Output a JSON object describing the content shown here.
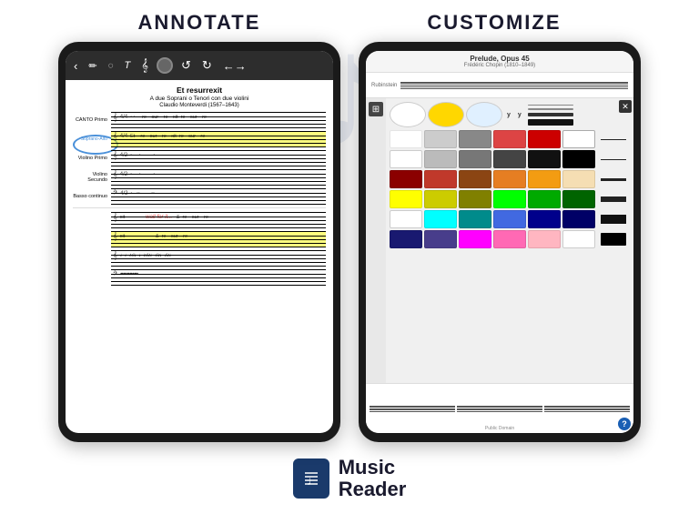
{
  "header": {
    "annotate_label": "ANNOTATE",
    "customize_label": "CUSTOMIZE"
  },
  "left_tablet": {
    "sheet": {
      "title": "Et resurrexit",
      "subtitle": "A due Soprani o Tenori con due violini",
      "composer": "Claudio Monteverdi (1567–1643)",
      "voices": [
        {
          "label": "CANTO Primo",
          "highlighted": false
        },
        {
          "label": "Soprano-Alto",
          "highlighted": true,
          "annotation": "wait for it..."
        },
        {
          "label": "Violino Primo",
          "highlighted": false
        },
        {
          "label": "Violino Secundo",
          "highlighted": false
        },
        {
          "label": "Basso continuo",
          "highlighted": false
        }
      ]
    },
    "toolbar": {
      "buttons": [
        "‹",
        "✏",
        "◯",
        "T",
        "𝄞",
        "●",
        "↺",
        "↻",
        "←→"
      ]
    }
  },
  "right_tablet": {
    "score_title": "Prelude, Opus 45",
    "score_composer": "Frédéric Chopin (1810–1849)",
    "color_panel": {
      "pen_samples": [
        {
          "type": "white"
        },
        {
          "type": "yellow"
        },
        {
          "type": "cyan"
        }
      ],
      "pen_labels": [
        "y",
        "y"
      ],
      "colors": [
        "#ffffff",
        "#dddddd",
        "#999999",
        "#555555",
        "#222222",
        "#000000",
        "#ffffff",
        "#dddddd",
        "#999999",
        "#555555",
        "#222222",
        "#000000",
        "#8b0000",
        "#c0392b",
        "#8b4513",
        "#e67e22",
        "#f39c12",
        "#f5deb3",
        "#ffff00",
        "#cccc00",
        "#808000",
        "#00ff00",
        "#008000",
        "#006400",
        "#ffffff",
        "#00ffff",
        "#008b8b",
        "#4169e1",
        "#00008b",
        "#00004d",
        "#000080",
        "#483d8b",
        "#ff00ff",
        "#ff69b4",
        "#ffb6c1",
        "#ffffff"
      ],
      "line_thicknesses": [
        "thin",
        "medium",
        "thick",
        "very-thick"
      ]
    },
    "public_domain": "Public Domain",
    "help": "?"
  },
  "footer": {
    "app_name": "Music\nReader",
    "logo_symbol": "♩"
  }
}
